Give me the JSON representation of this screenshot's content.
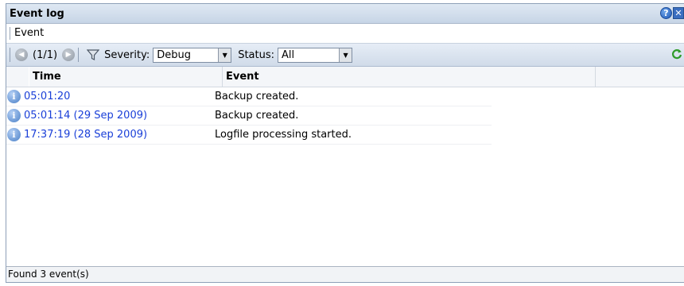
{
  "window": {
    "title": "Event log"
  },
  "tabs": [
    {
      "label": "Event"
    }
  ],
  "toolbar": {
    "pager": "(1/1)",
    "severity_label": "Severity:",
    "severity_value": "Debug",
    "status_label": "Status:",
    "status_value": "All"
  },
  "table": {
    "columns": [
      "Time",
      "Event"
    ],
    "rows": [
      {
        "time": "05:01:20",
        "event": "Backup created."
      },
      {
        "time": "05:01:14 (29 Sep 2009)",
        "event": "Backup created."
      },
      {
        "time": "17:37:19 (28 Sep 2009)",
        "event": "Logfile processing started."
      }
    ]
  },
  "status": {
    "text": "Found 3 event(s)"
  },
  "colors": {
    "link": "#1a3fd8",
    "titlebar": "#c7d5e6",
    "toolbar": "#d0dbe9"
  }
}
